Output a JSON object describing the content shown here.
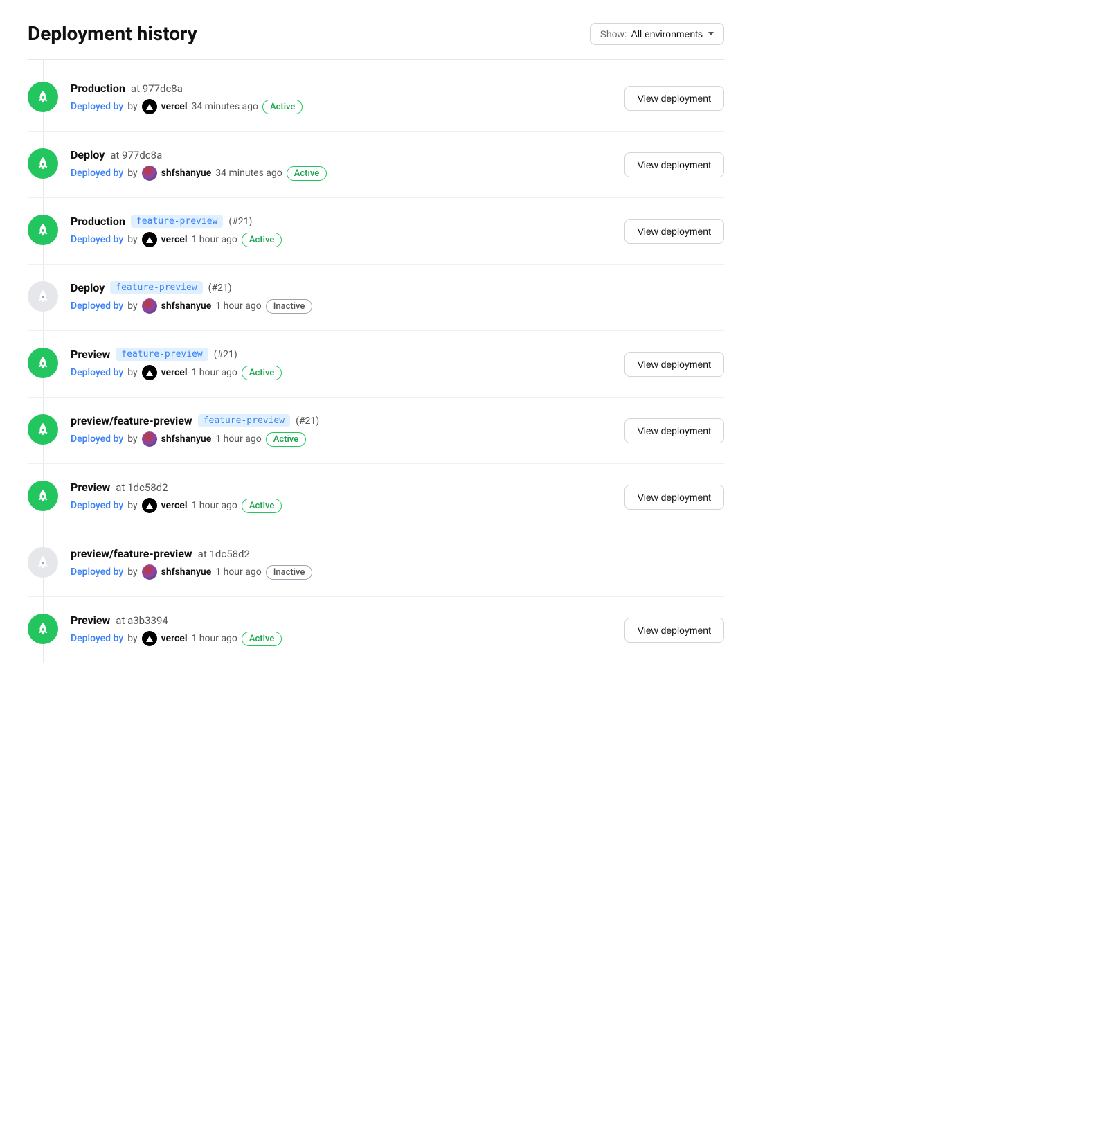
{
  "header": {
    "title": "Deployment history",
    "filter_label": "Show:",
    "filter_value": "All environments"
  },
  "deployments": [
    {
      "id": 1,
      "environment": "Production",
      "hash": "at 977dc8a",
      "branch": null,
      "pr": null,
      "deployed_by_label": "Deployed by",
      "deployer_type": "vercel",
      "deployer_name": "vercel",
      "time_ago": "34 minutes ago",
      "status": "Active",
      "status_type": "active",
      "show_button": true,
      "button_label": "View deployment",
      "icon_state": "active"
    },
    {
      "id": 2,
      "environment": "Deploy",
      "hash": "at 977dc8a",
      "branch": null,
      "pr": null,
      "deployed_by_label": "Deployed by",
      "deployer_type": "user",
      "deployer_name": "shfshanyue",
      "time_ago": "34 minutes ago",
      "status": "Active",
      "status_type": "active",
      "show_button": true,
      "button_label": "View deployment",
      "icon_state": "active"
    },
    {
      "id": 3,
      "environment": "Production",
      "hash": null,
      "branch": "feature-preview",
      "pr": "(#21)",
      "deployed_by_label": "Deployed by",
      "deployer_type": "vercel",
      "deployer_name": "vercel",
      "time_ago": "1 hour ago",
      "status": "Active",
      "status_type": "active",
      "show_button": true,
      "button_label": "View deployment",
      "icon_state": "active"
    },
    {
      "id": 4,
      "environment": "Deploy",
      "hash": null,
      "branch": "feature-preview",
      "pr": "(#21)",
      "deployed_by_label": "Deployed by",
      "deployer_type": "user",
      "deployer_name": "shfshanyue",
      "time_ago": "1 hour ago",
      "status": "Inactive",
      "status_type": "inactive",
      "show_button": false,
      "button_label": null,
      "icon_state": "inactive"
    },
    {
      "id": 5,
      "environment": "Preview",
      "hash": null,
      "branch": "feature-preview",
      "pr": "(#21)",
      "deployed_by_label": "Deployed by",
      "deployer_type": "vercel",
      "deployer_name": "vercel",
      "time_ago": "1 hour ago",
      "status": "Active",
      "status_type": "active",
      "show_button": true,
      "button_label": "View deployment",
      "icon_state": "active"
    },
    {
      "id": 6,
      "environment": "preview/feature-preview",
      "hash": null,
      "branch": "feature-preview",
      "pr": "(#21)",
      "deployed_by_label": "Deployed by",
      "deployer_type": "user",
      "deployer_name": "shfshanyue",
      "time_ago": "1 hour ago",
      "status": "Active",
      "status_type": "active",
      "show_button": true,
      "button_label": "View deployment",
      "icon_state": "active"
    },
    {
      "id": 7,
      "environment": "Preview",
      "hash": "at 1dc58d2",
      "branch": null,
      "pr": null,
      "deployed_by_label": "Deployed by",
      "deployer_type": "vercel",
      "deployer_name": "vercel",
      "time_ago": "1 hour ago",
      "status": "Active",
      "status_type": "active",
      "show_button": true,
      "button_label": "View deployment",
      "icon_state": "active"
    },
    {
      "id": 8,
      "environment": "preview/feature-preview",
      "hash": "at 1dc58d2",
      "branch": null,
      "pr": null,
      "deployed_by_label": "Deployed by",
      "deployer_type": "user",
      "deployer_name": "shfshanyue",
      "time_ago": "1 hour ago",
      "status": "Inactive",
      "status_type": "inactive",
      "show_button": false,
      "button_label": null,
      "icon_state": "inactive"
    },
    {
      "id": 9,
      "environment": "Preview",
      "hash": "at a3b3394",
      "branch": null,
      "pr": null,
      "deployed_by_label": "Deployed by",
      "deployer_type": "vercel",
      "deployer_name": "vercel",
      "time_ago": "1 hour ago",
      "status": "Active",
      "status_type": "active",
      "show_button": true,
      "button_label": "View deployment",
      "icon_state": "active"
    }
  ]
}
